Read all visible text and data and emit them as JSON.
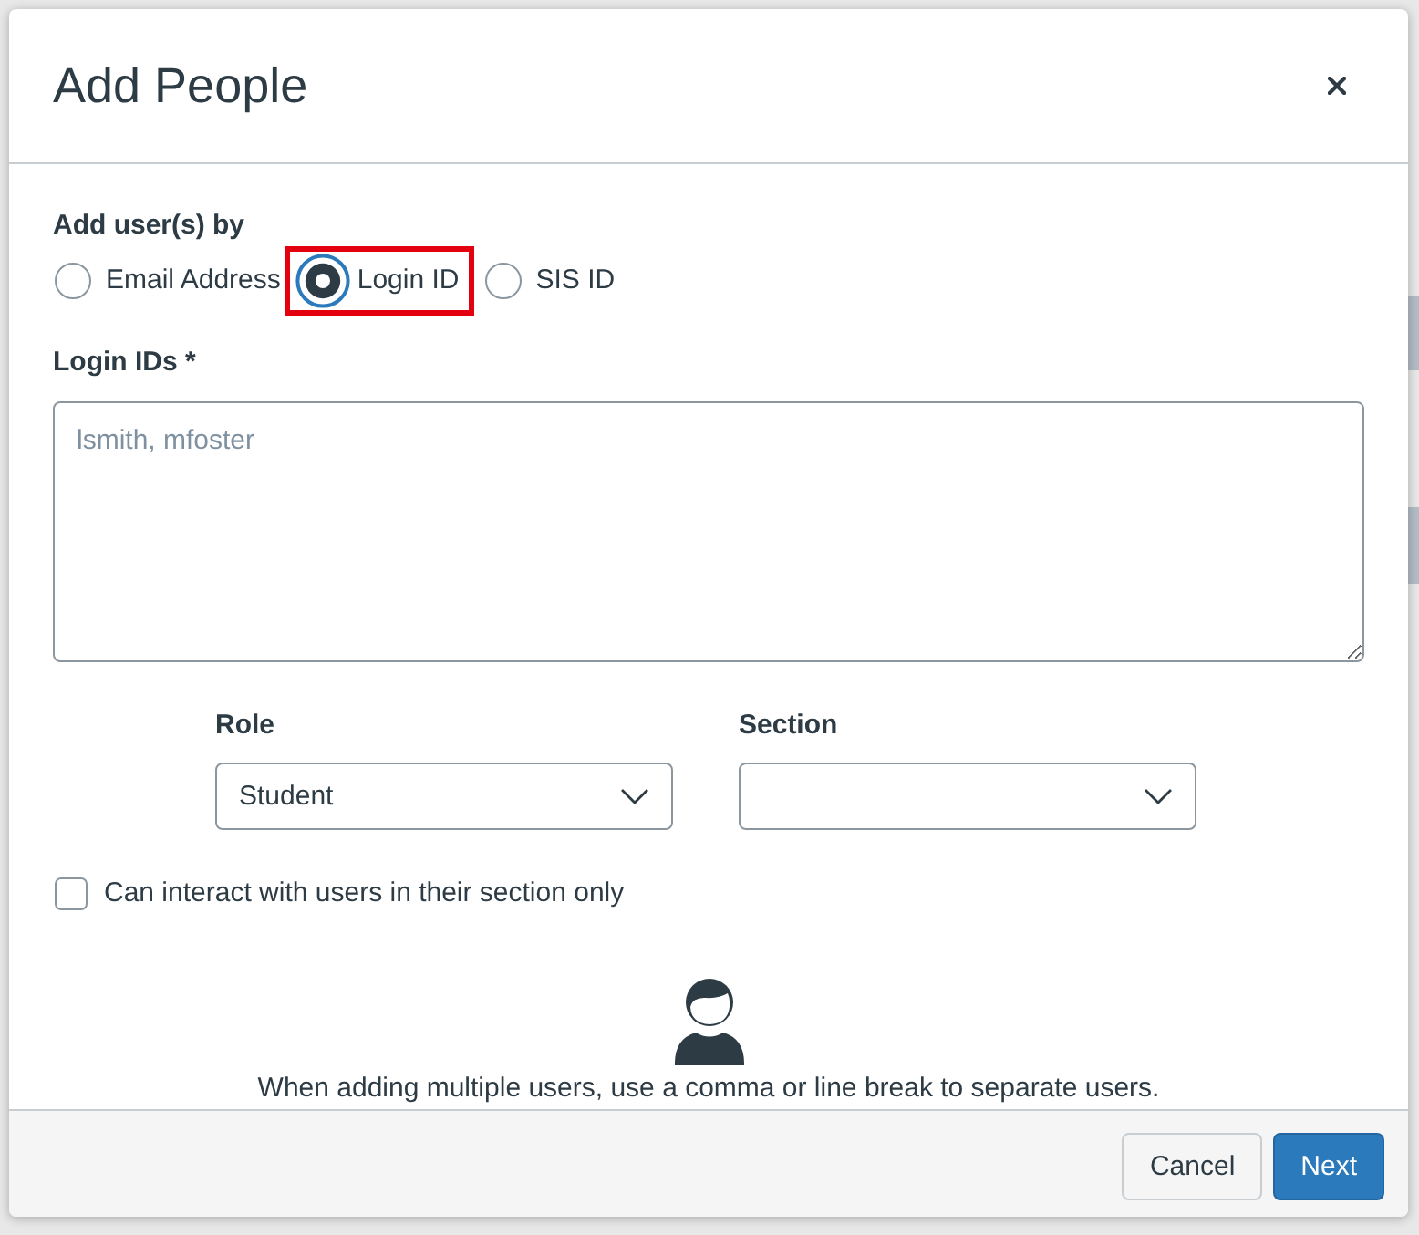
{
  "dialog": {
    "title": "Add People"
  },
  "add_by": {
    "label": "Add user(s) by",
    "options": [
      {
        "label": "Email Address",
        "selected": false,
        "focused": false,
        "highlighted": false
      },
      {
        "label": "Login ID",
        "selected": true,
        "focused": true,
        "highlighted": true
      },
      {
        "label": "SIS ID",
        "selected": false,
        "focused": false,
        "highlighted": false
      }
    ]
  },
  "ids_field": {
    "label": "Login IDs *",
    "placeholder": "lsmith, mfoster"
  },
  "dropdowns": [
    {
      "label": "Role",
      "value": "Student"
    },
    {
      "label": "Section"
    }
  ],
  "section_only": {
    "label": "Can interact with users in their section only",
    "checked": false
  },
  "hint": {
    "text": "When adding multiple users, use a comma or line break to separate users."
  },
  "buttons": [
    {
      "label": "Cancel",
      "kind": "secondary"
    },
    {
      "label": "Next",
      "kind": "primary"
    }
  ]
}
